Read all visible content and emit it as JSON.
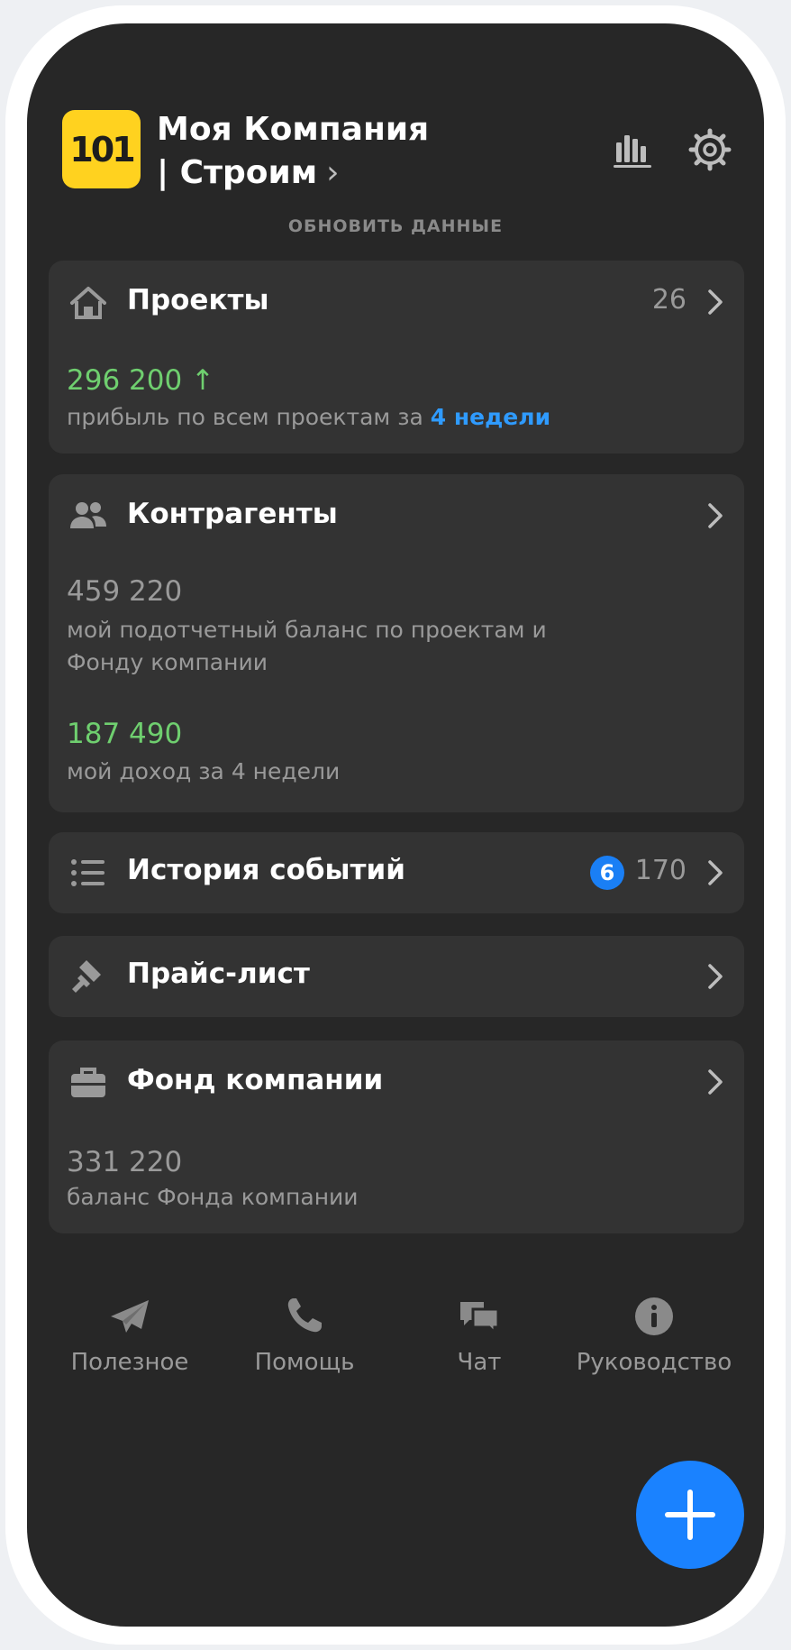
{
  "header": {
    "logo_text": "101",
    "company_line1": "Моя Компания",
    "company_line2": "| Строим",
    "refresh_label": "ОБНОВИТЬ ДАННЫЕ",
    "icons": [
      "stats-icon",
      "settings-icon"
    ]
  },
  "projects": {
    "title": "Проекты",
    "count": "26",
    "value": "296 200",
    "arrow": "↑",
    "caption": "прибыль по всем проектам за ",
    "period_link": "4 недели"
  },
  "contractors": {
    "title": "Контрагенты",
    "balance_value": "459 220",
    "balance_caption_line1": "мой подотчетный баланс по проектам и",
    "balance_caption_line2": "Фонду компании",
    "income_value": "187 490",
    "income_caption": "мой доход за 4 недели"
  },
  "history": {
    "title": "История событий",
    "badge": "6",
    "count": "170"
  },
  "pricelist": {
    "title": "Прайс-лист"
  },
  "fund": {
    "title": "Фонд компании",
    "value": "331 220",
    "caption": "баланс Фонда компании"
  },
  "bottom_nav": {
    "useful": "Полезное",
    "help": "Помощь",
    "chat": "Чат",
    "guide": "Руководство"
  },
  "colors": {
    "background": "#272727",
    "card": "#333333",
    "positive": "#6fcf6f",
    "accent": "#1a82ff",
    "logo": "#ffd21f"
  }
}
